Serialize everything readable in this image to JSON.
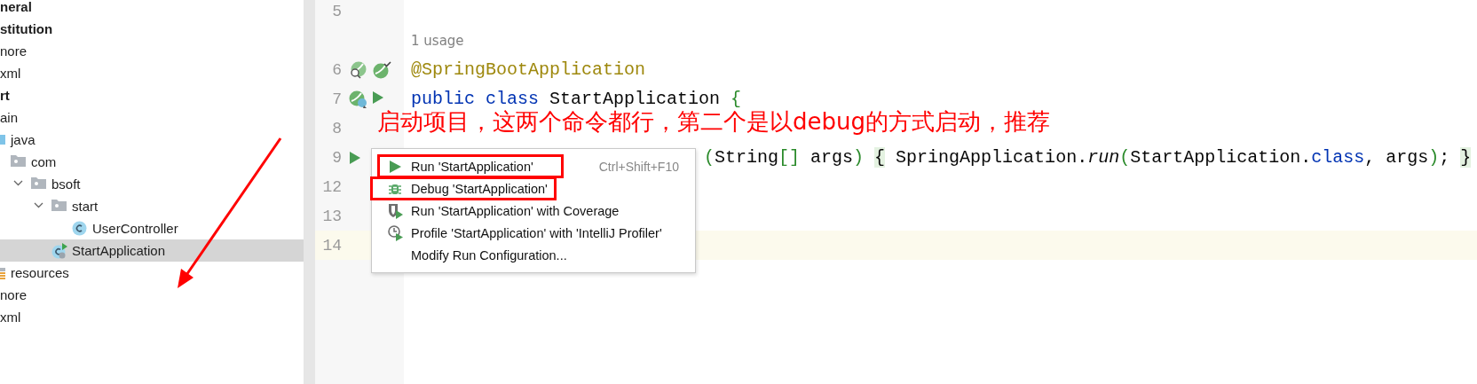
{
  "project_tree": {
    "items": [
      {
        "label": "neral",
        "kind": "module",
        "selected": false
      },
      {
        "label": "stitution",
        "kind": "module",
        "selected": false
      },
      {
        "label": "nore",
        "kind": "file",
        "selected": false
      },
      {
        "label": "xml",
        "kind": "file",
        "selected": false
      },
      {
        "label": "rt",
        "kind": "module",
        "selected": false,
        "children": [
          {
            "label": "ain",
            "selected": false,
            "children": [
              {
                "label": "java",
                "kind": "source",
                "selected": false,
                "children": [
                  {
                    "label": "com",
                    "kind": "package",
                    "selected": false,
                    "children": [
                      {
                        "label": "bsoft",
                        "kind": "package",
                        "selected": false,
                        "expanded": true,
                        "children": [
                          {
                            "label": "start",
                            "kind": "package",
                            "selected": false,
                            "expanded": true,
                            "children": [
                              {
                                "label": "UserController",
                                "kind": "class",
                                "selected": false
                              }
                            ]
                          },
                          {
                            "label": "StartApplication",
                            "kind": "app",
                            "selected": true
                          }
                        ]
                      }
                    ]
                  }
                ]
              },
              {
                "label": "resources",
                "kind": "resources",
                "selected": false
              }
            ]
          }
        ]
      },
      {
        "label": "nore",
        "kind": "file",
        "selected": false
      },
      {
        "label": "xml",
        "kind": "file",
        "selected": false
      }
    ]
  },
  "editor": {
    "lines": [
      {
        "kind": "code",
        "number": "5"
      },
      {
        "kind": "hint",
        "text": "1 usage"
      },
      {
        "kind": "code",
        "number": "6",
        "gutter_icons": [
          {
            "kind": "spring-search"
          },
          {
            "kind": "spring-check"
          }
        ],
        "tokens": [
          {
            "kind": "annotation",
            "text": "@SpringBootApplication"
          }
        ]
      },
      {
        "kind": "code",
        "number": "7",
        "gutter_icons": [
          {
            "kind": "spring"
          },
          {
            "kind": "run"
          }
        ],
        "tokens": [
          {
            "kind": "keyword",
            "text": "public "
          },
          {
            "kind": "keyword",
            "text": "class "
          },
          {
            "kind": "plain",
            "text": "StartApplication "
          },
          {
            "kind": "brace",
            "text": "{"
          }
        ]
      },
      {
        "kind": "code",
        "number": "8"
      },
      {
        "kind": "covered",
        "number": "9",
        "gutter_icons": [
          {
            "kind": "run"
          }
        ],
        "tokens": [
          {
            "kind": "brace",
            "text": "("
          },
          {
            "kind": "plain",
            "text": "String"
          },
          {
            "kind": "brace",
            "text": "[]"
          },
          {
            "kind": "plain",
            "text": " args"
          },
          {
            "kind": "brace",
            "text": ") "
          },
          {
            "kind": "matched",
            "text": "{"
          },
          {
            "kind": "plain",
            "text": " SpringApplication."
          },
          {
            "kind": "italic",
            "text": "run"
          },
          {
            "kind": "brace",
            "text": "("
          },
          {
            "kind": "plain",
            "text": "StartApplication."
          },
          {
            "kind": "keyword",
            "text": "class"
          },
          {
            "kind": "plain",
            "text": ", args"
          },
          {
            "kind": "brace",
            "text": ")"
          },
          {
            "kind": "plain",
            "text": "; "
          },
          {
            "kind": "matched",
            "text": "}"
          }
        ]
      },
      {
        "kind": "code",
        "number": "12"
      },
      {
        "kind": "code",
        "number": "13"
      },
      {
        "kind": "current",
        "number": "14"
      }
    ]
  },
  "popup_menu": {
    "items": [
      {
        "kind": "run",
        "label": "Run 'StartApplication'",
        "shortcut": "Ctrl+Shift+F10",
        "boxed": true
      },
      {
        "kind": "debug",
        "label": "Debug 'StartApplication'",
        "boxed": true
      },
      {
        "kind": "coverage",
        "label": "Run 'StartApplication' with Coverage",
        "boxed": false
      },
      {
        "kind": "profile",
        "label": "Profile 'StartApplication' with 'IntelliJ Profiler'",
        "boxed": false
      },
      {
        "kind": "plain",
        "label": "Modify Run Configuration...",
        "boxed": false
      }
    ]
  },
  "annotation": {
    "text": "启动项目，这两个命令都行，第二个是以debug的方式启动，推荐"
  }
}
